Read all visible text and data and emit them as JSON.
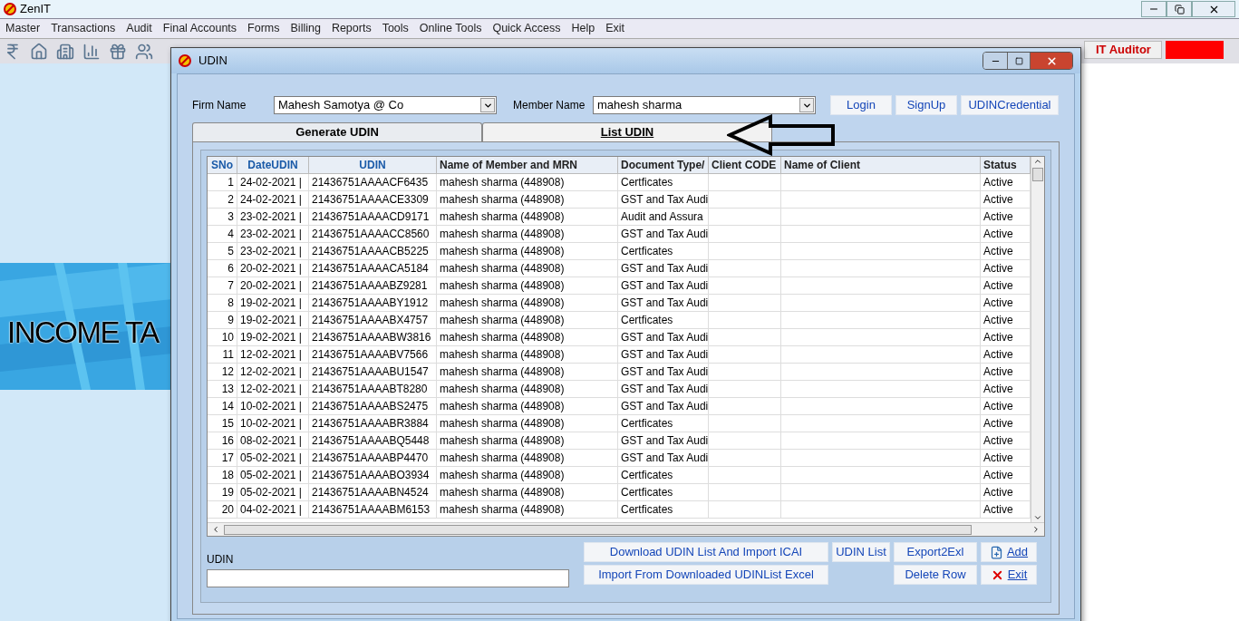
{
  "app": {
    "title": "ZenIT"
  },
  "menu": [
    {
      "label": "Master"
    },
    {
      "label": "Transactions"
    },
    {
      "label": "Audit"
    },
    {
      "label": "Final Accounts"
    },
    {
      "label": "Forms"
    },
    {
      "label": "Billing"
    },
    {
      "label": "Reports"
    },
    {
      "label": "Tools"
    },
    {
      "label": "Online Tools"
    },
    {
      "label": "Quick Access"
    },
    {
      "label": "Help"
    },
    {
      "label": "Exit"
    }
  ],
  "toolbar": [
    {
      "kind": "rupee"
    },
    {
      "kind": "home"
    },
    {
      "kind": "building"
    },
    {
      "kind": "chart"
    },
    {
      "kind": "gift"
    },
    {
      "kind": "users"
    }
  ],
  "banner": {
    "text": "INCOME TA"
  },
  "side_panel": {
    "label": "IT Auditor"
  },
  "dialog": {
    "title": "UDIN",
    "firm_name": {
      "label": "Firm Name",
      "value": "Mahesh Samotya @ Co"
    },
    "member_name": {
      "label": "Member Name",
      "value": "mahesh sharma"
    },
    "top_buttons": [
      "Login",
      "SignUp",
      "UDINCredential"
    ],
    "tabs": [
      {
        "label": "Generate UDIN",
        "selected": false
      },
      {
        "label": "List UDIN",
        "selected": true
      }
    ],
    "table": {
      "columns": [
        "SNo",
        "DateUDIN",
        "UDIN",
        "Name of Member and MRN",
        "Document Type/",
        "Client CODE",
        "Name of Client",
        "Status"
      ],
      "rows": [
        [
          "1",
          "24-02-2021 |",
          "21436751AAAACF6435",
          "mahesh sharma (448908)",
          "Certficates",
          "",
          "",
          "Active"
        ],
        [
          "2",
          "24-02-2021 |",
          "21436751AAAACE3309",
          "mahesh sharma (448908)",
          "GST and Tax Audi",
          "",
          "",
          "Active"
        ],
        [
          "3",
          "23-02-2021 |",
          "21436751AAAACD9171",
          "mahesh sharma (448908)",
          "Audit and Assura",
          "",
          "",
          "Active"
        ],
        [
          "4",
          "23-02-2021 |",
          "21436751AAAACC8560",
          "mahesh sharma (448908)",
          "GST and Tax Audi",
          "",
          "",
          "Active"
        ],
        [
          "5",
          "23-02-2021 |",
          "21436751AAAACB5225",
          "mahesh sharma (448908)",
          "Certficates",
          "",
          "",
          "Active"
        ],
        [
          "6",
          "20-02-2021 |",
          "21436751AAAACA5184",
          "mahesh sharma (448908)",
          "GST and Tax Audi",
          "",
          "",
          "Active"
        ],
        [
          "7",
          "20-02-2021 |",
          "21436751AAAABZ9281",
          "mahesh sharma (448908)",
          "GST and Tax Audi",
          "",
          "",
          "Active"
        ],
        [
          "8",
          "19-02-2021 |",
          "21436751AAAABY1912",
          "mahesh sharma (448908)",
          "GST and Tax Audi",
          "",
          "",
          "Active"
        ],
        [
          "9",
          "19-02-2021 |",
          "21436751AAAABX4757",
          "mahesh sharma (448908)",
          "Certficates",
          "",
          "",
          "Active"
        ],
        [
          "10",
          "19-02-2021 |",
          "21436751AAAABW3816",
          "mahesh sharma (448908)",
          "GST and Tax Audi",
          "",
          "",
          "Active"
        ],
        [
          "11",
          "12-02-2021 |",
          "21436751AAAABV7566",
          "mahesh sharma (448908)",
          "GST and Tax Audi",
          "",
          "",
          "Active"
        ],
        [
          "12",
          "12-02-2021 |",
          "21436751AAAABU1547",
          "mahesh sharma (448908)",
          "GST and Tax Audi",
          "",
          "",
          "Active"
        ],
        [
          "13",
          "12-02-2021 |",
          "21436751AAAABT8280",
          "mahesh sharma (448908)",
          "GST and Tax Audi",
          "",
          "",
          "Active"
        ],
        [
          "14",
          "10-02-2021 |",
          "21436751AAAABS2475",
          "mahesh sharma (448908)",
          "GST and Tax Audi",
          "",
          "",
          "Active"
        ],
        [
          "15",
          "10-02-2021 |",
          "21436751AAAABR3884",
          "mahesh sharma (448908)",
          "Certficates",
          "",
          "",
          "Active"
        ],
        [
          "16",
          "08-02-2021 |",
          "21436751AAAABQ5448",
          "mahesh sharma (448908)",
          "GST and Tax Audi",
          "",
          "",
          "Active"
        ],
        [
          "17",
          "05-02-2021 |",
          "21436751AAAABP4470",
          "mahesh sharma (448908)",
          "GST and Tax Audi",
          "",
          "",
          "Active"
        ],
        [
          "18",
          "05-02-2021 |",
          "21436751AAAABO3934",
          "mahesh sharma (448908)",
          "Certficates",
          "",
          "",
          "Active"
        ],
        [
          "19",
          "05-02-2021 |",
          "21436751AAAABN4524",
          "mahesh sharma (448908)",
          "Certficates",
          "",
          "",
          "Active"
        ],
        [
          "20",
          "04-02-2021 |",
          "21436751AAAABM6153",
          "mahesh sharma (448908)",
          "Certficates",
          "",
          "",
          "Active"
        ]
      ]
    },
    "udin_field": {
      "label": "UDIN"
    },
    "bottom_buttons": [
      {
        "label": "Download UDIN List And Import ICAI"
      },
      {
        "label": "UDIN List"
      },
      {
        "label": "Export2Exl"
      },
      {
        "label": "Add",
        "kind": "add"
      },
      {
        "label": "Import From Downloaded UDINList Excel"
      },
      {
        "label": "Delete Row"
      },
      {
        "label": "Exit",
        "kind": "exit"
      }
    ]
  }
}
